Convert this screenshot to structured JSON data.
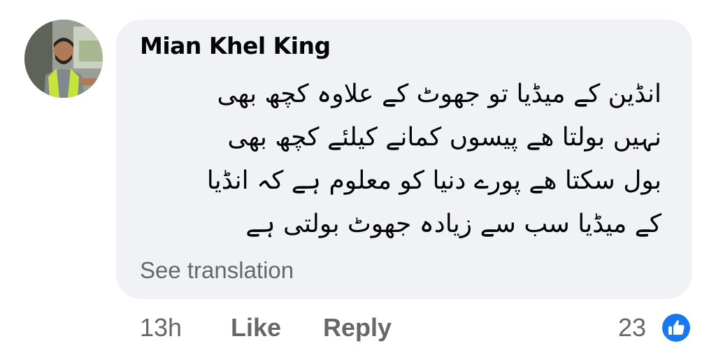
{
  "comment": {
    "author": "Mian Khel King",
    "text": "انڈین کے میڈیا تو جھوٹ کے علاوہ کچھ بھی\nنہیں بولتا ھے پیسوں کمانے کیلئے کچھ بھی\nبول سکتا ھے پورے دنیا کو معلوم ہے کہ انڈیا\nکے میڈیا سب سے زیادہ جھوٹ بولتی ہے",
    "see_translation": "See translation",
    "timestamp": "13h",
    "like_label": "Like",
    "reply_label": "Reply",
    "reaction_count": "23",
    "reaction_icon": "thumbs-up-icon"
  },
  "colors": {
    "bubble": "#f0f2f5",
    "text": "#050505",
    "secondary": "#65676b",
    "like_blue": "#1877f2"
  }
}
